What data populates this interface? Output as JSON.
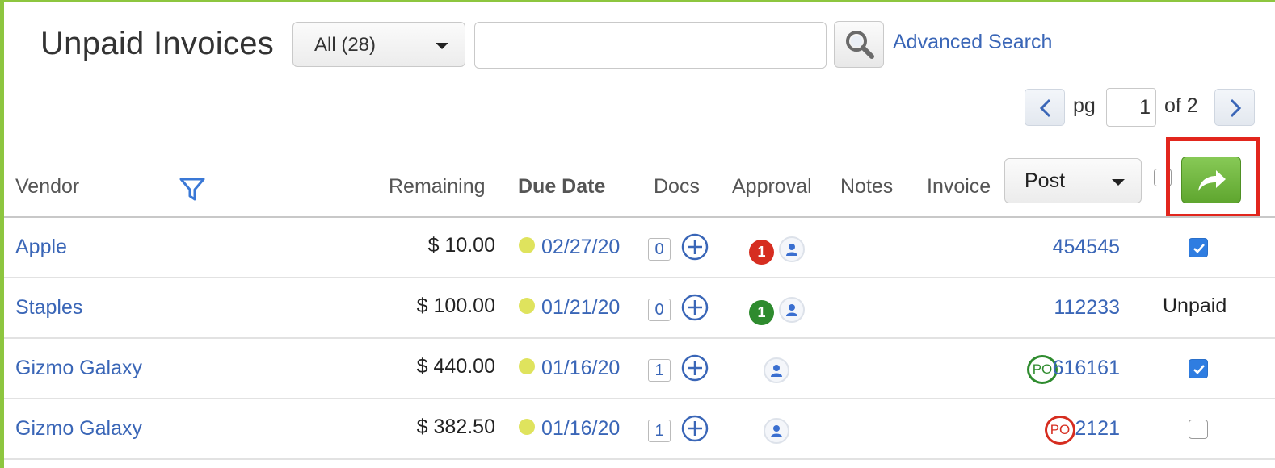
{
  "header": {
    "title": "Unpaid Invoices",
    "filter_select": "All (28)",
    "search_placeholder": "",
    "advanced_search": "Advanced Search"
  },
  "pagination": {
    "pg_label": "pg",
    "current_page": "1",
    "of_label": "of 2"
  },
  "columns": {
    "vendor": "Vendor",
    "remaining": "Remaining",
    "due_date": "Due Date",
    "docs": "Docs",
    "approval": "Approval",
    "notes": "Notes",
    "invoice": "Invoice",
    "action_select": "Post"
  },
  "rows": [
    {
      "vendor": "Apple",
      "remaining": "$ 10.00",
      "due_date": "02/27/20",
      "docs": "0",
      "approval_badge": "1",
      "approval_color": "red",
      "po": "",
      "invoice": "454545",
      "status": "checked"
    },
    {
      "vendor": "Staples",
      "remaining": "$ 100.00",
      "due_date": "01/21/20",
      "docs": "0",
      "approval_badge": "1",
      "approval_color": "green",
      "po": "",
      "invoice": "112233",
      "status_text": "Unpaid"
    },
    {
      "vendor": "Gizmo Galaxy",
      "remaining": "$ 440.00",
      "due_date": "01/16/20",
      "docs": "1",
      "approval_badge": "",
      "po": "PO",
      "po_color": "green",
      "invoice": "616161",
      "status": "checked"
    },
    {
      "vendor": "Gizmo Galaxy",
      "remaining": "$ 382.50",
      "due_date": "01/16/20",
      "docs": "1",
      "approval_badge": "",
      "po": "PO",
      "po_color": "red",
      "invoice": "2121",
      "status": "unchecked"
    }
  ],
  "colors": {
    "accent_green": "#8dc63f",
    "link_blue": "#3a66b7",
    "highlight_red": "#e2261d",
    "due_dot": "#dfe35d"
  }
}
